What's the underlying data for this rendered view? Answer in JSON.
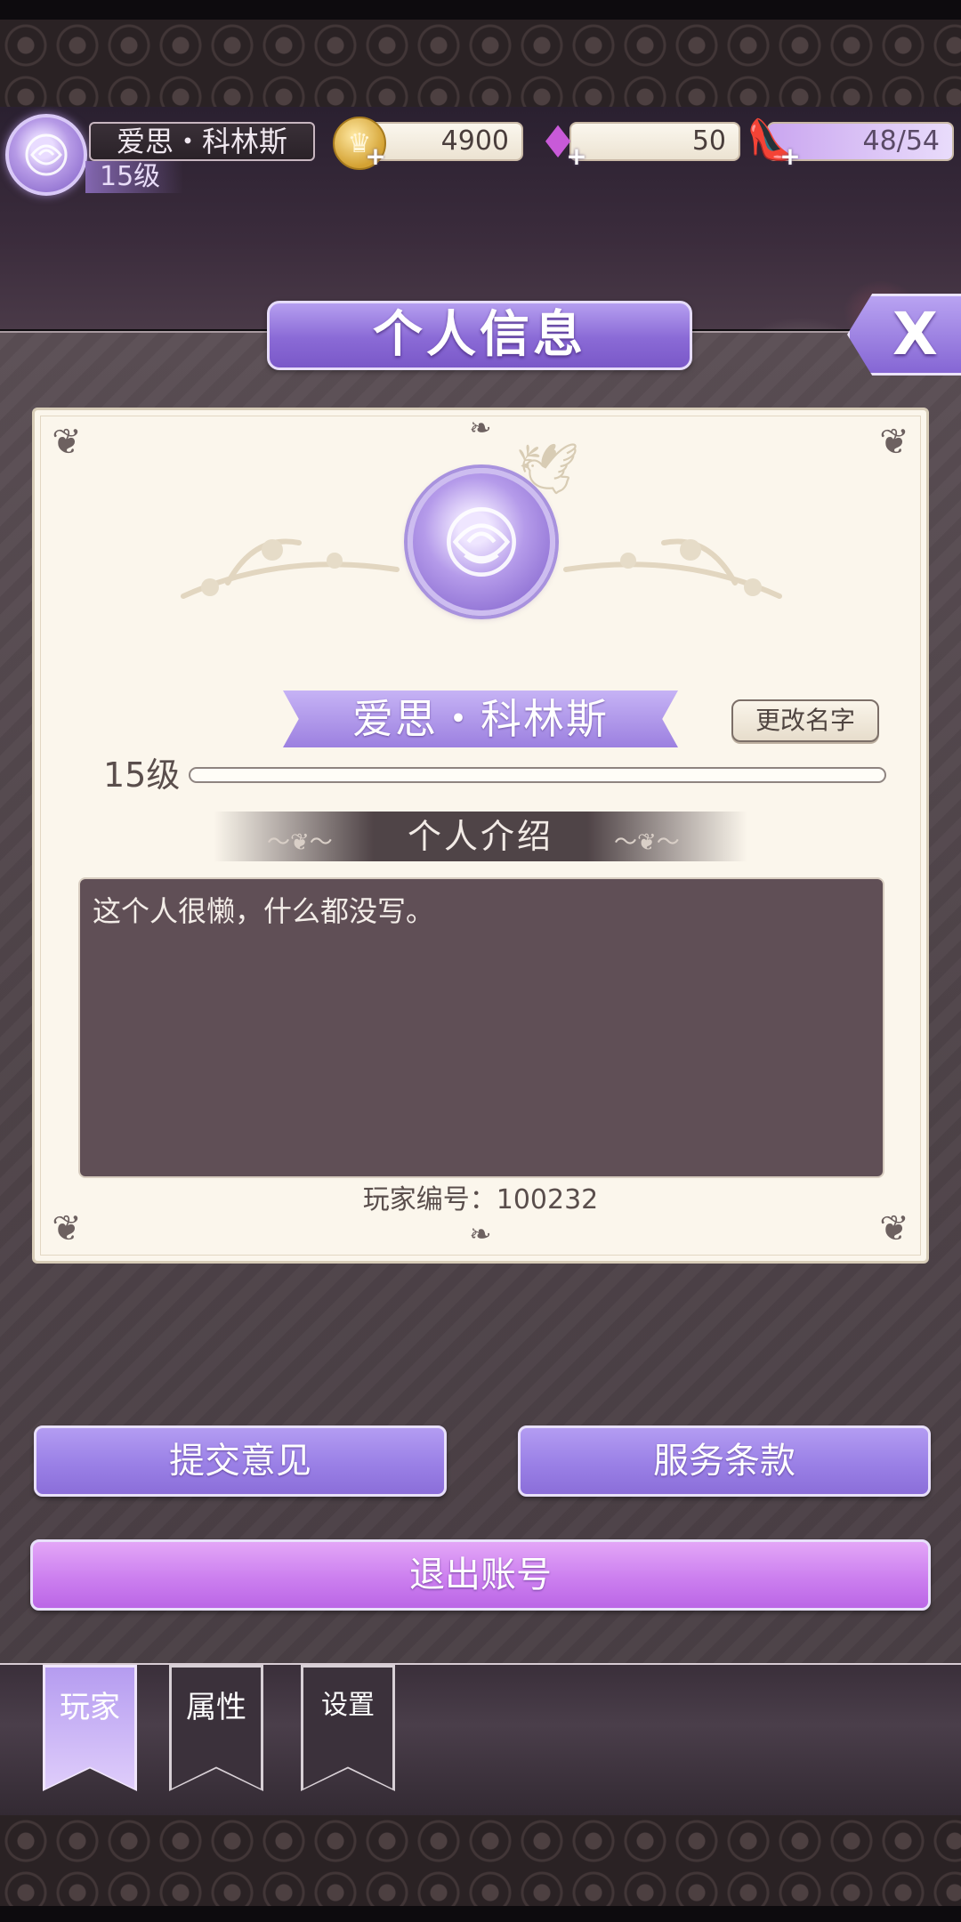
{
  "hud": {
    "player_name": "爱思・科林斯",
    "player_level": "15级",
    "coins": "4900",
    "gems": "50",
    "energy": "48/54"
  },
  "icons": {
    "avatar": "rose-avatar-icon",
    "coin": "crown-coin-icon",
    "gem": "diamond-icon",
    "energy": "glass-slipper-icon",
    "close": "close-icon"
  },
  "panel": {
    "title": "个人信息",
    "close_label": "X",
    "name": "爱思・科林斯",
    "rename_label": "更改名字",
    "level": "15级",
    "exp_progress": 0,
    "intro_header": "个人介绍",
    "intro_text": "这个人很懒，什么都没写。",
    "player_id": "玩家编号：100232"
  },
  "actions": {
    "feedback": "提交意见",
    "terms": "服务条款",
    "logout": "退出账号"
  },
  "nav": {
    "tabs": [
      {
        "label": "玩家",
        "active": true
      },
      {
        "label": "属性",
        "active": false
      },
      {
        "label": "设置",
        "active": false
      }
    ]
  },
  "colors": {
    "accent_purple": "#9a80e6",
    "logout_pink": "#cc7fef",
    "card_bg": "#fbf6ec",
    "textarea_bg": "#604f56"
  }
}
